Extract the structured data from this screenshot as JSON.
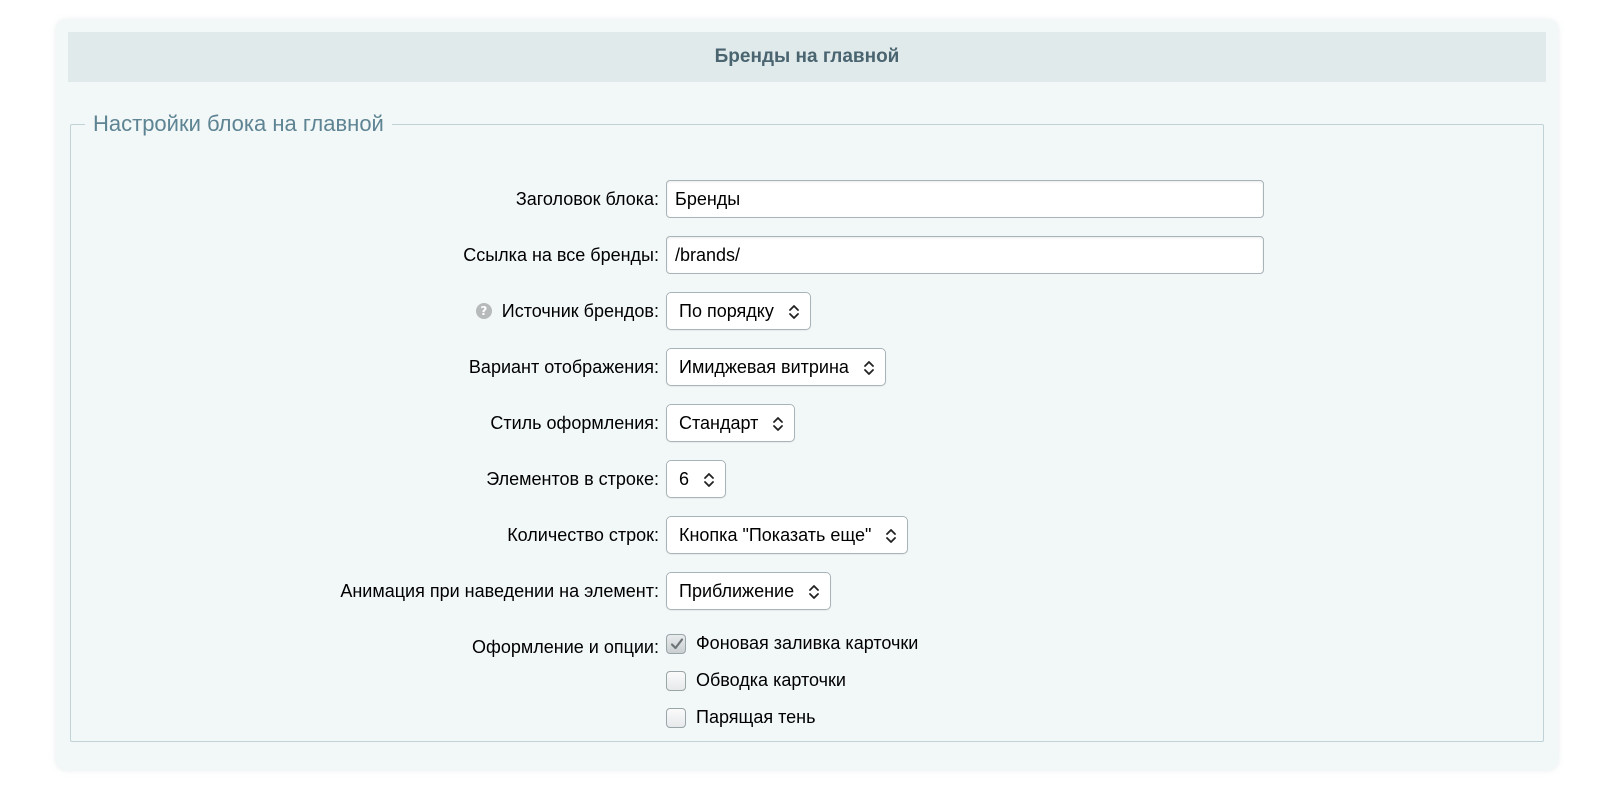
{
  "header": {
    "title": "Бренды на главной"
  },
  "fieldset": {
    "legend": "Настройки блока на главной"
  },
  "fields": {
    "block_title": {
      "label": "Заголовок блока:",
      "value": "Бренды"
    },
    "all_brands_link": {
      "label": "Ссылка на все бренды:",
      "value": "/brands/"
    },
    "brands_source": {
      "label": "Источник брендов:",
      "value": "По порядку",
      "help_icon": "question-circle-icon"
    },
    "display_variant": {
      "label": "Вариант отображения:",
      "value": "Имиджевая витрина"
    },
    "style": {
      "label": "Стиль оформления:",
      "value": "Стандарт"
    },
    "items_per_row": {
      "label": "Элементов в строке:",
      "value": "6"
    },
    "rows_count": {
      "label": "Количество строк:",
      "value": "Кнопка \"Показать еще\""
    },
    "hover_animation": {
      "label": "Анимация при наведении на элемент:",
      "value": "Приближение"
    }
  },
  "options": {
    "label": "Оформление и опции:",
    "items": [
      {
        "label": "Фоновая заливка карточки",
        "checked": true
      },
      {
        "label": "Обводка карточки",
        "checked": false
      },
      {
        "label": "Парящая тень",
        "checked": false
      }
    ]
  },
  "colors": {
    "header_bg": "#e0eaeb",
    "panel_bg": "#f2f7f7",
    "legend_text": "#5e8493",
    "header_text": "#4a6470"
  }
}
